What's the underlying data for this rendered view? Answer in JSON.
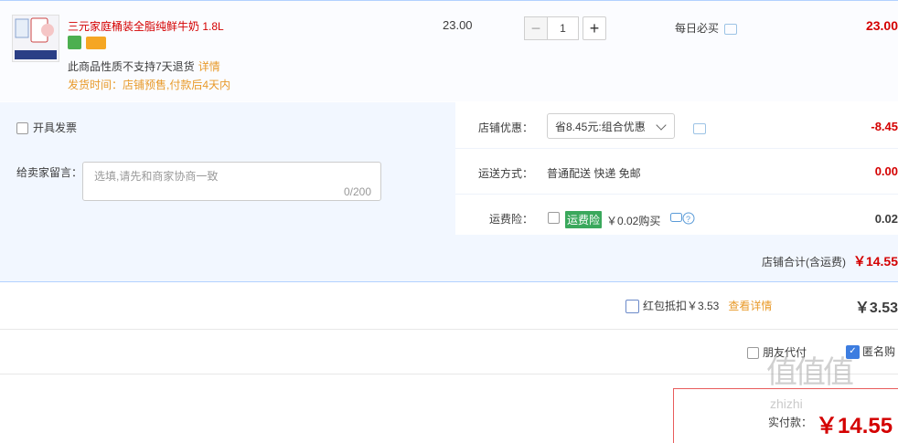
{
  "item": {
    "title": "三元家庭桶装全脂纯鲜牛奶 1.8L",
    "notice": "此商品性质不支持7天退货",
    "notice_link": "详情",
    "ship_time": "发货时间：店铺预售,付款后4天内",
    "unit_price": "23.00",
    "quantity": "1",
    "minus": "−",
    "plus": "+",
    "promo": "每日必买",
    "subtotal": "23.00"
  },
  "options": {
    "invoice_label": "开具发票",
    "message_label": "给卖家留言：",
    "message_placeholder": "选填,请先和商家协商一致",
    "message_count": "0/200",
    "discount_label": "店铺优惠：",
    "discount_value": "省8.45元:组合优惠",
    "discount_amount": "-8.45",
    "shipping_label": "运送方式：",
    "shipping_value": "普通配送 快递 免邮",
    "shipping_amount": "0.00",
    "insurance_label": "运费险：",
    "insurance_badge": "运费险",
    "insurance_price": "￥0.02购买",
    "insurance_amount": "0.02",
    "store_total_label": "店铺合计(含运费)",
    "store_total_amount": "￥14.55"
  },
  "redpacket": {
    "label": "红包抵扣￥3.53",
    "link": "查看详情",
    "amount": "￥3.53"
  },
  "footer": {
    "friend_pay": "朋友代付",
    "anonymous": "匿名购",
    "pay_label": "实付款：",
    "pay_amount": "￥14.55",
    "watermark": "值值值",
    "watermark_url": "zhizhi"
  },
  "colors": {
    "price_red": "#d40000",
    "link_orange": "#e89a2a",
    "check_blue": "#3d7de0"
  }
}
